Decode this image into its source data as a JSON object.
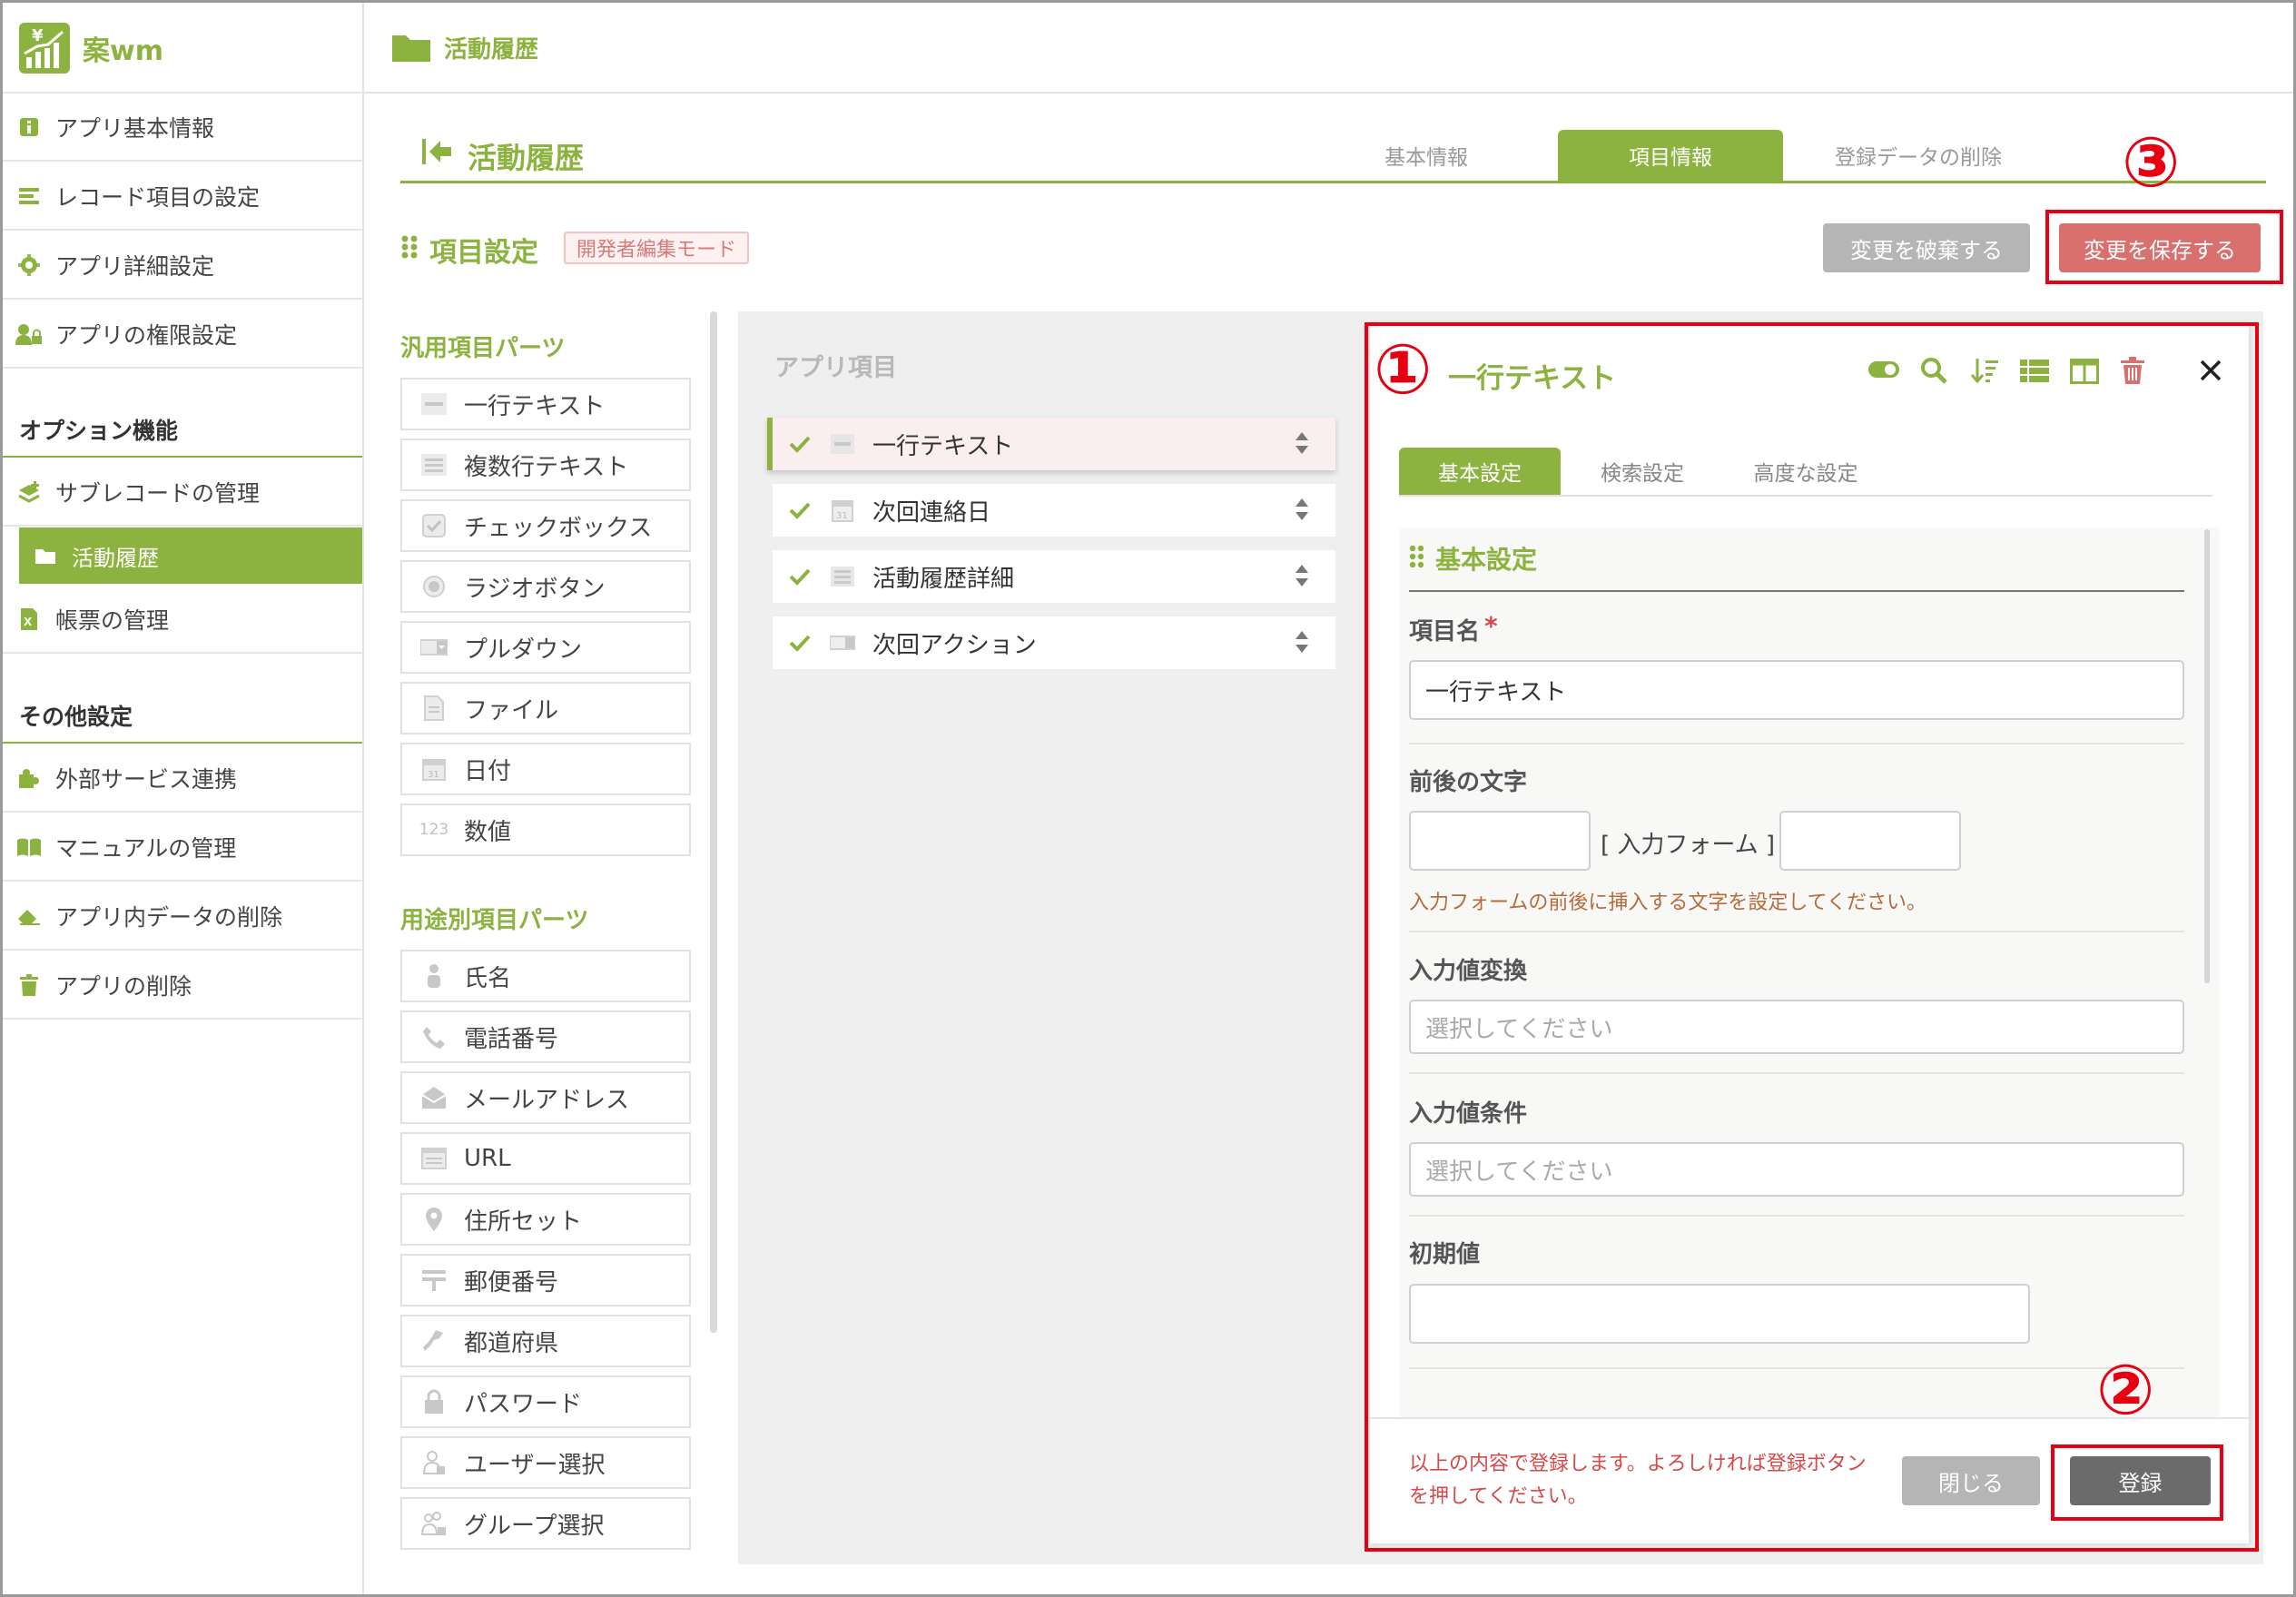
{
  "app": {
    "name": "案wm",
    "breadcrumb": "活動履歴"
  },
  "sidebar": {
    "items_top": [
      {
        "label": "アプリ基本情報",
        "icon": "info-icon"
      },
      {
        "label": "レコード項目の設定",
        "icon": "list-icon"
      },
      {
        "label": "アプリ詳細設定",
        "icon": "gear-icon"
      },
      {
        "label": "アプリの権限設定",
        "icon": "user-lock-icon"
      }
    ],
    "section_option": "オプション機能",
    "items_option": [
      {
        "label": "サブレコードの管理",
        "icon": "layers-icon"
      },
      {
        "label": "活動履歴",
        "icon": "folder-icon",
        "active": true
      },
      {
        "label": "帳票の管理",
        "icon": "excel-icon"
      }
    ],
    "section_other": "その他設定",
    "items_other": [
      {
        "label": "外部サービス連携",
        "icon": "puzzle-icon"
      },
      {
        "label": "マニュアルの管理",
        "icon": "book-icon"
      },
      {
        "label": "アプリ内データの削除",
        "icon": "eraser-icon"
      },
      {
        "label": "アプリの削除",
        "icon": "trash-icon"
      }
    ]
  },
  "page": {
    "title": "活動履歴",
    "tabs": [
      "基本情報",
      "項目情報",
      "登録データの削除"
    ],
    "active_tab": "項目情報",
    "section_title": "項目設定",
    "mode_badge": "開発者編集モード",
    "discard_label": "変更を破棄する",
    "save_label": "変更を保存する"
  },
  "parts": {
    "general_title": "汎用項目パーツ",
    "general": [
      "一行テキスト",
      "複数行テキスト",
      "チェックボックス",
      "ラジオボタン",
      "プルダウン",
      "ファイル",
      "日付",
      "数値"
    ],
    "number_icon_text": "123",
    "purpose_title": "用途別項目パーツ",
    "purpose": [
      "氏名",
      "電話番号",
      "メールアドレス",
      "URL",
      "住所セット",
      "郵便番号",
      "都道府県",
      "パスワード",
      "ユーザー選択",
      "グループ選択"
    ]
  },
  "app_items": {
    "title": "アプリ項目",
    "items": [
      "一行テキスト",
      "次回連絡日",
      "活動履歴詳細",
      "次回アクション"
    ]
  },
  "editor": {
    "title": "一行テキスト",
    "tabs": [
      "基本設定",
      "検索設定",
      "高度な設定"
    ],
    "active_tab": "基本設定",
    "section": "基本設定",
    "field_name_label": "項目名",
    "required_mark": "*",
    "field_name_value": "一行テキスト",
    "affix_label": "前後の文字",
    "affix_middle": "[ 入力フォーム ]",
    "affix_hint": "入力フォームの前後に挿入する文字を設定してください。",
    "convert_label": "入力値変換",
    "convert_placeholder": "選択してください",
    "condition_label": "入力値条件",
    "condition_placeholder": "選択してください",
    "default_label": "初期値",
    "footer_note": "以上の内容で登録します。よろしければ登録ボタンを押してください。",
    "close_label": "閉じる",
    "register_label": "登録"
  },
  "annotations": {
    "n1": "①",
    "n2": "②",
    "n3": "③"
  },
  "colors": {
    "accent": "#8cb33f",
    "save": "#d9706d",
    "discard": "#b5b5b5",
    "highlight": "#e60012"
  }
}
